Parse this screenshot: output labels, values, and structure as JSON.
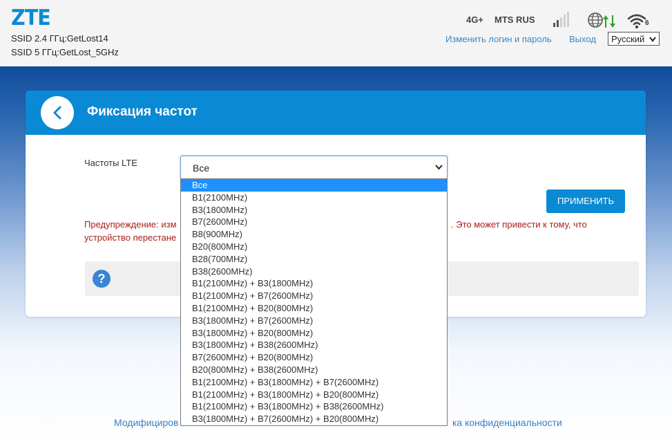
{
  "header": {
    "logo": "ZTE",
    "ssid_24": "SSID 2.4 ГГц:GetLost14",
    "ssid_5": "SSID 5 ГГц:GetLost_5GHz",
    "network_type": "4G+",
    "operator": "MTS RUS",
    "wifi_clients": "6",
    "change_login_link": "Изменить логин и пароль",
    "logout_link": "Выход",
    "language": "Русский",
    "icons": {
      "signal": "signal-bars-icon",
      "internet": "globe-icon",
      "traffic": "updown-arrows-icon",
      "wifi": "wifi-icon"
    },
    "colors": {
      "brand": "#0a8ad4",
      "link": "#3a87c8",
      "traffic": "#2aa12a"
    }
  },
  "card": {
    "title": "Фиксация частот",
    "back_icon": "chevron-left-icon",
    "lte_label": "Частоты LTE",
    "lte_selected": "Все",
    "apply_label": "ПРИМЕНИТЬ",
    "warning_left_1": "Предупреждение: изм",
    "warning_right_1": ". Это может привести к тому, что",
    "warning_left_2": "устройство перестане",
    "help_icon": "question-icon"
  },
  "dropdown": {
    "options": [
      "Все",
      "B1(2100MHz)",
      "B3(1800MHz)",
      "B7(2600MHz)",
      "B8(900MHz)",
      "B20(800MHz)",
      "B28(700MHz)",
      "B38(2600MHz)",
      "B1(2100MHz) + B3(1800MHz)",
      "B1(2100MHz) + B7(2600MHz)",
      "B1(2100MHz) + B20(800MHz)",
      "B3(1800MHz) + B7(2600MHz)",
      "B3(1800MHz) + B20(800MHz)",
      "B3(1800MHz) + B38(2600MHz)",
      "B7(2600MHz) + B20(800MHz)",
      "B20(800MHz) + B38(2600MHz)",
      "B1(2100MHz) + B3(1800MHz) + B7(2600MHz)",
      "B1(2100MHz) + B3(1800MHz) + B20(800MHz)",
      "B1(2100MHz) + B3(1800MHz) + B38(2600MHz)",
      "B3(1800MHz) + B7(2600MHz) + B20(800MHz)"
    ],
    "selected_index": 0
  },
  "footer": {
    "left_text": "Модифициров",
    "right_text": "ка конфиденциальности"
  }
}
